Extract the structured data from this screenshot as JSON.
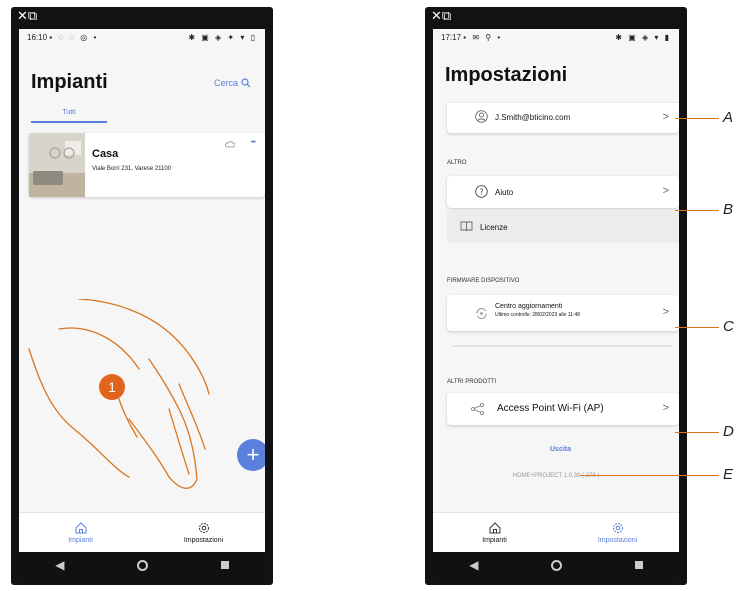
{
  "left_phone": {
    "status_time": "16:10",
    "status_left_icons": "▪ ◌ ◌ ◎ •",
    "status_right_icons": "✱ ▣ ◈ ✦ ▾ ▯",
    "header_title": "Impianti",
    "search_label": "Cerca",
    "tab_all": "Tutti",
    "plant_card": {
      "name": "Casa",
      "address": "Viale Borri 231, Varese 21100",
      "more": "•••"
    },
    "step_number": "1",
    "add_button": "+",
    "bottom_tabs": [
      {
        "label": "Impianti",
        "icon": "home-icon",
        "active": true
      },
      {
        "label": "Impostazioni",
        "icon": "gear-icon",
        "active": false
      }
    ]
  },
  "right_phone": {
    "status_time": "17:17",
    "status_left_icons": "▪ ✉ ⚲ •",
    "status_right_icons": "✱ ▣ ◈ ▾ ▮",
    "header_title": "Impostazioni",
    "account_email": "J.Smith@bticino.com",
    "section_altro": "ALTRO",
    "help_label": "Aiuto",
    "license_label": "Licenze",
    "section_firmware": "FIRMWARE DISPOSITIVO",
    "update_center_label": "Centro aggiornamenti",
    "update_center_sub": "Ultimo controllo: 28/02/2023 alle 11:48",
    "section_other_products": "ALTRI PRODOTTI",
    "access_point_label": "Access Point Wi-Fi (AP)",
    "logout_label": "Uscita",
    "version": "HOME+PROJECT 1.0.38 ( 279 )",
    "bottom_tabs": [
      {
        "label": "Impianti",
        "icon": "home-icon",
        "active": false
      },
      {
        "label": "Impostazioni",
        "icon": "gear-icon",
        "active": true
      }
    ]
  },
  "callouts": [
    "A",
    "B",
    "C",
    "D",
    "E"
  ],
  "colors": {
    "accent": "#5b7fdc",
    "orange": "#d8761e",
    "step_badge": "#e0641b"
  }
}
